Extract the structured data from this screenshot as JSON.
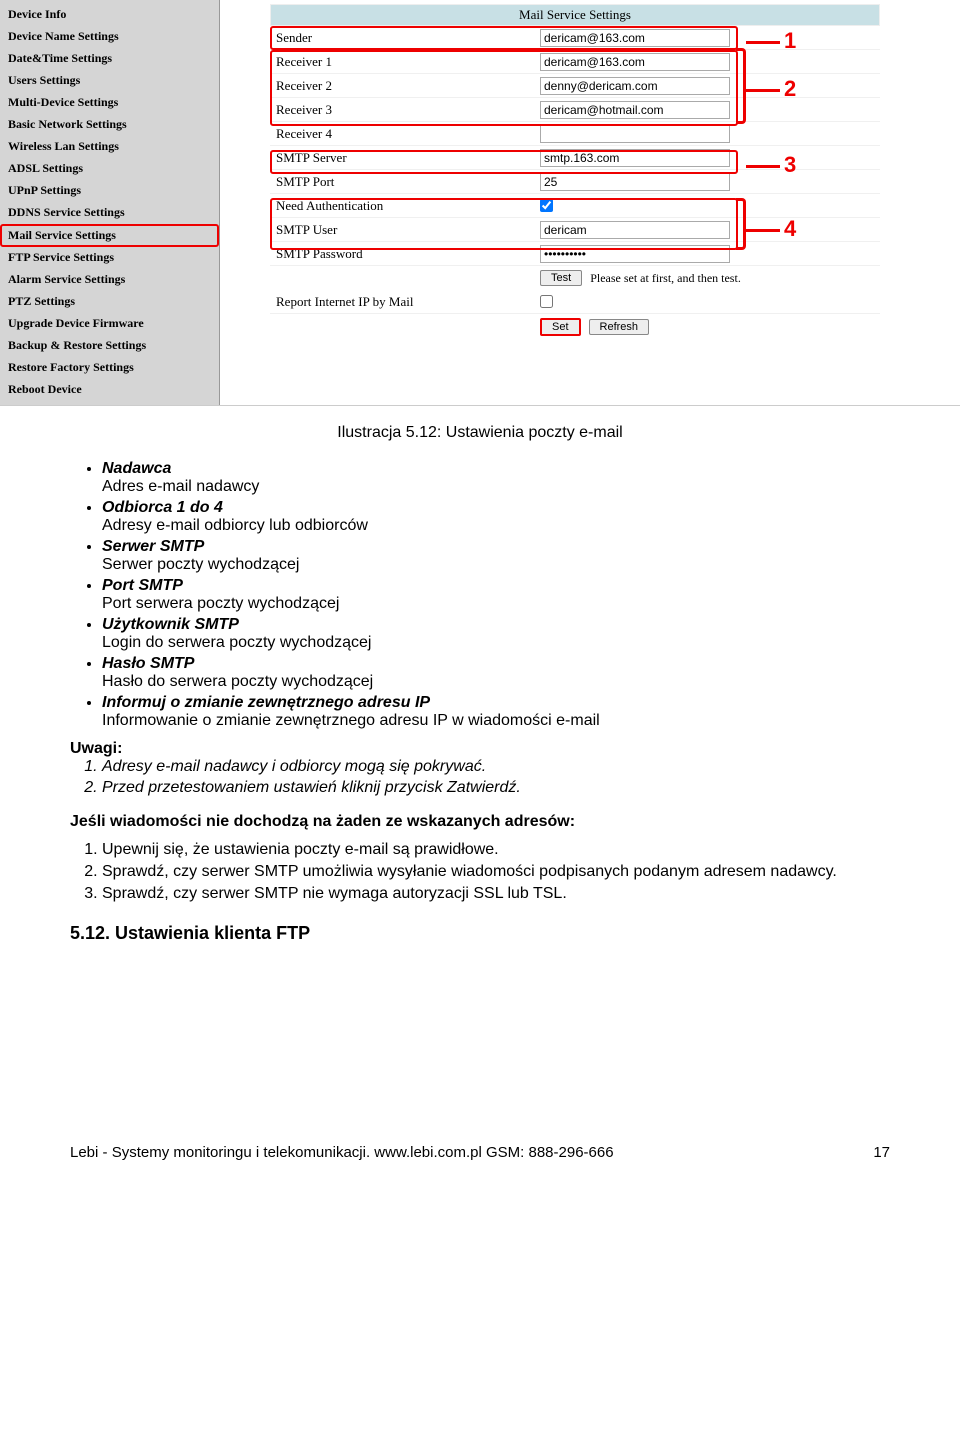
{
  "sidebar": {
    "items": [
      "Device Info",
      "Device Name Settings",
      "Date&Time Settings",
      "Users Settings",
      "Multi-Device Settings",
      "Basic Network Settings",
      "Wireless Lan Settings",
      "ADSL Settings",
      "UPnP Settings",
      "DDNS Service Settings",
      "Mail Service Settings",
      "FTP Service Settings",
      "Alarm Service Settings",
      "PTZ Settings",
      "Upgrade Device Firmware",
      "Backup & Restore Settings",
      "Restore Factory Settings",
      "Reboot Device"
    ],
    "selected_index": 10
  },
  "form": {
    "header": "Mail Service Settings",
    "rows": {
      "sender": {
        "label": "Sender",
        "value": "dericam@163.com"
      },
      "receiver1": {
        "label": "Receiver 1",
        "value": "dericam@163.com"
      },
      "receiver2": {
        "label": "Receiver 2",
        "value": "denny@dericam.com"
      },
      "receiver3": {
        "label": "Receiver 3",
        "value": "dericam@hotmail.com"
      },
      "receiver4": {
        "label": "Receiver 4",
        "value": ""
      },
      "smtp_server": {
        "label": "SMTP Server",
        "value": "smtp.163.com"
      },
      "smtp_port": {
        "label": "SMTP Port",
        "value": "25"
      },
      "need_auth": {
        "label": "Need Authentication",
        "checked": true
      },
      "smtp_user": {
        "label": "SMTP User",
        "value": "dericam"
      },
      "smtp_password": {
        "label": "SMTP Password",
        "value": "••••••••••"
      },
      "report_ip": {
        "label": "Report Internet IP by Mail",
        "checked": false
      }
    },
    "test_button": "Test",
    "test_note": "Please set at first, and then test.",
    "set_button": "Set",
    "refresh_button": "Refresh"
  },
  "markers": {
    "m1": "1",
    "m2": "2",
    "m3": "3",
    "m4": "4"
  },
  "caption": "Ilustracja 5.12: Ustawienia poczty e-mail",
  "bullets": [
    {
      "title": "Nadawca",
      "desc": "Adres e-mail nadawcy"
    },
    {
      "title": "Odbiorca 1 do 4",
      "desc": "Adresy e-mail odbiorcy lub odbiorców"
    },
    {
      "title": "Serwer SMTP",
      "desc": "Serwer poczty wychodzącej"
    },
    {
      "title": "Port SMTP",
      "desc": "Port serwera poczty wychodzącej"
    },
    {
      "title": "Użytkownik SMTP",
      "desc": "Login do serwera poczty wychodzącej"
    },
    {
      "title": "Hasło SMTP",
      "desc": "Hasło do serwera poczty wychodzącej"
    },
    {
      "title": "Informuj o zmianie zewnętrznego adresu IP",
      "desc": "Informowanie o zmianie zewnętrznego adresu IP w wiadomości e-mail"
    }
  ],
  "uwagi": {
    "heading": "Uwagi:",
    "items": [
      "Adresy e-mail nadawcy i odbiorcy mogą się pokrywać.",
      "Przed przetestowaniem ustawień kliknij przycisk Zatwierdź."
    ]
  },
  "trouble": {
    "heading": "Jeśli wiadomości nie dochodzą na żaden ze wskazanych adresów:",
    "items": [
      "Upewnij się, że ustawienia poczty e-mail są prawidłowe.",
      "Sprawdź, czy serwer SMTP umożliwia wysyłanie wiadomości podpisanych podanym adresem nadawcy.",
      "Sprawdź, czy serwer SMTP nie wymaga autoryzacji SSL lub TSL."
    ]
  },
  "section_512": "5.12. Ustawienia klienta FTP",
  "footer": {
    "left": "Lebi - Systemy monitoringu i telekomunikacji. www.lebi.com.pl GSM: 888-296-666",
    "right": "17"
  }
}
